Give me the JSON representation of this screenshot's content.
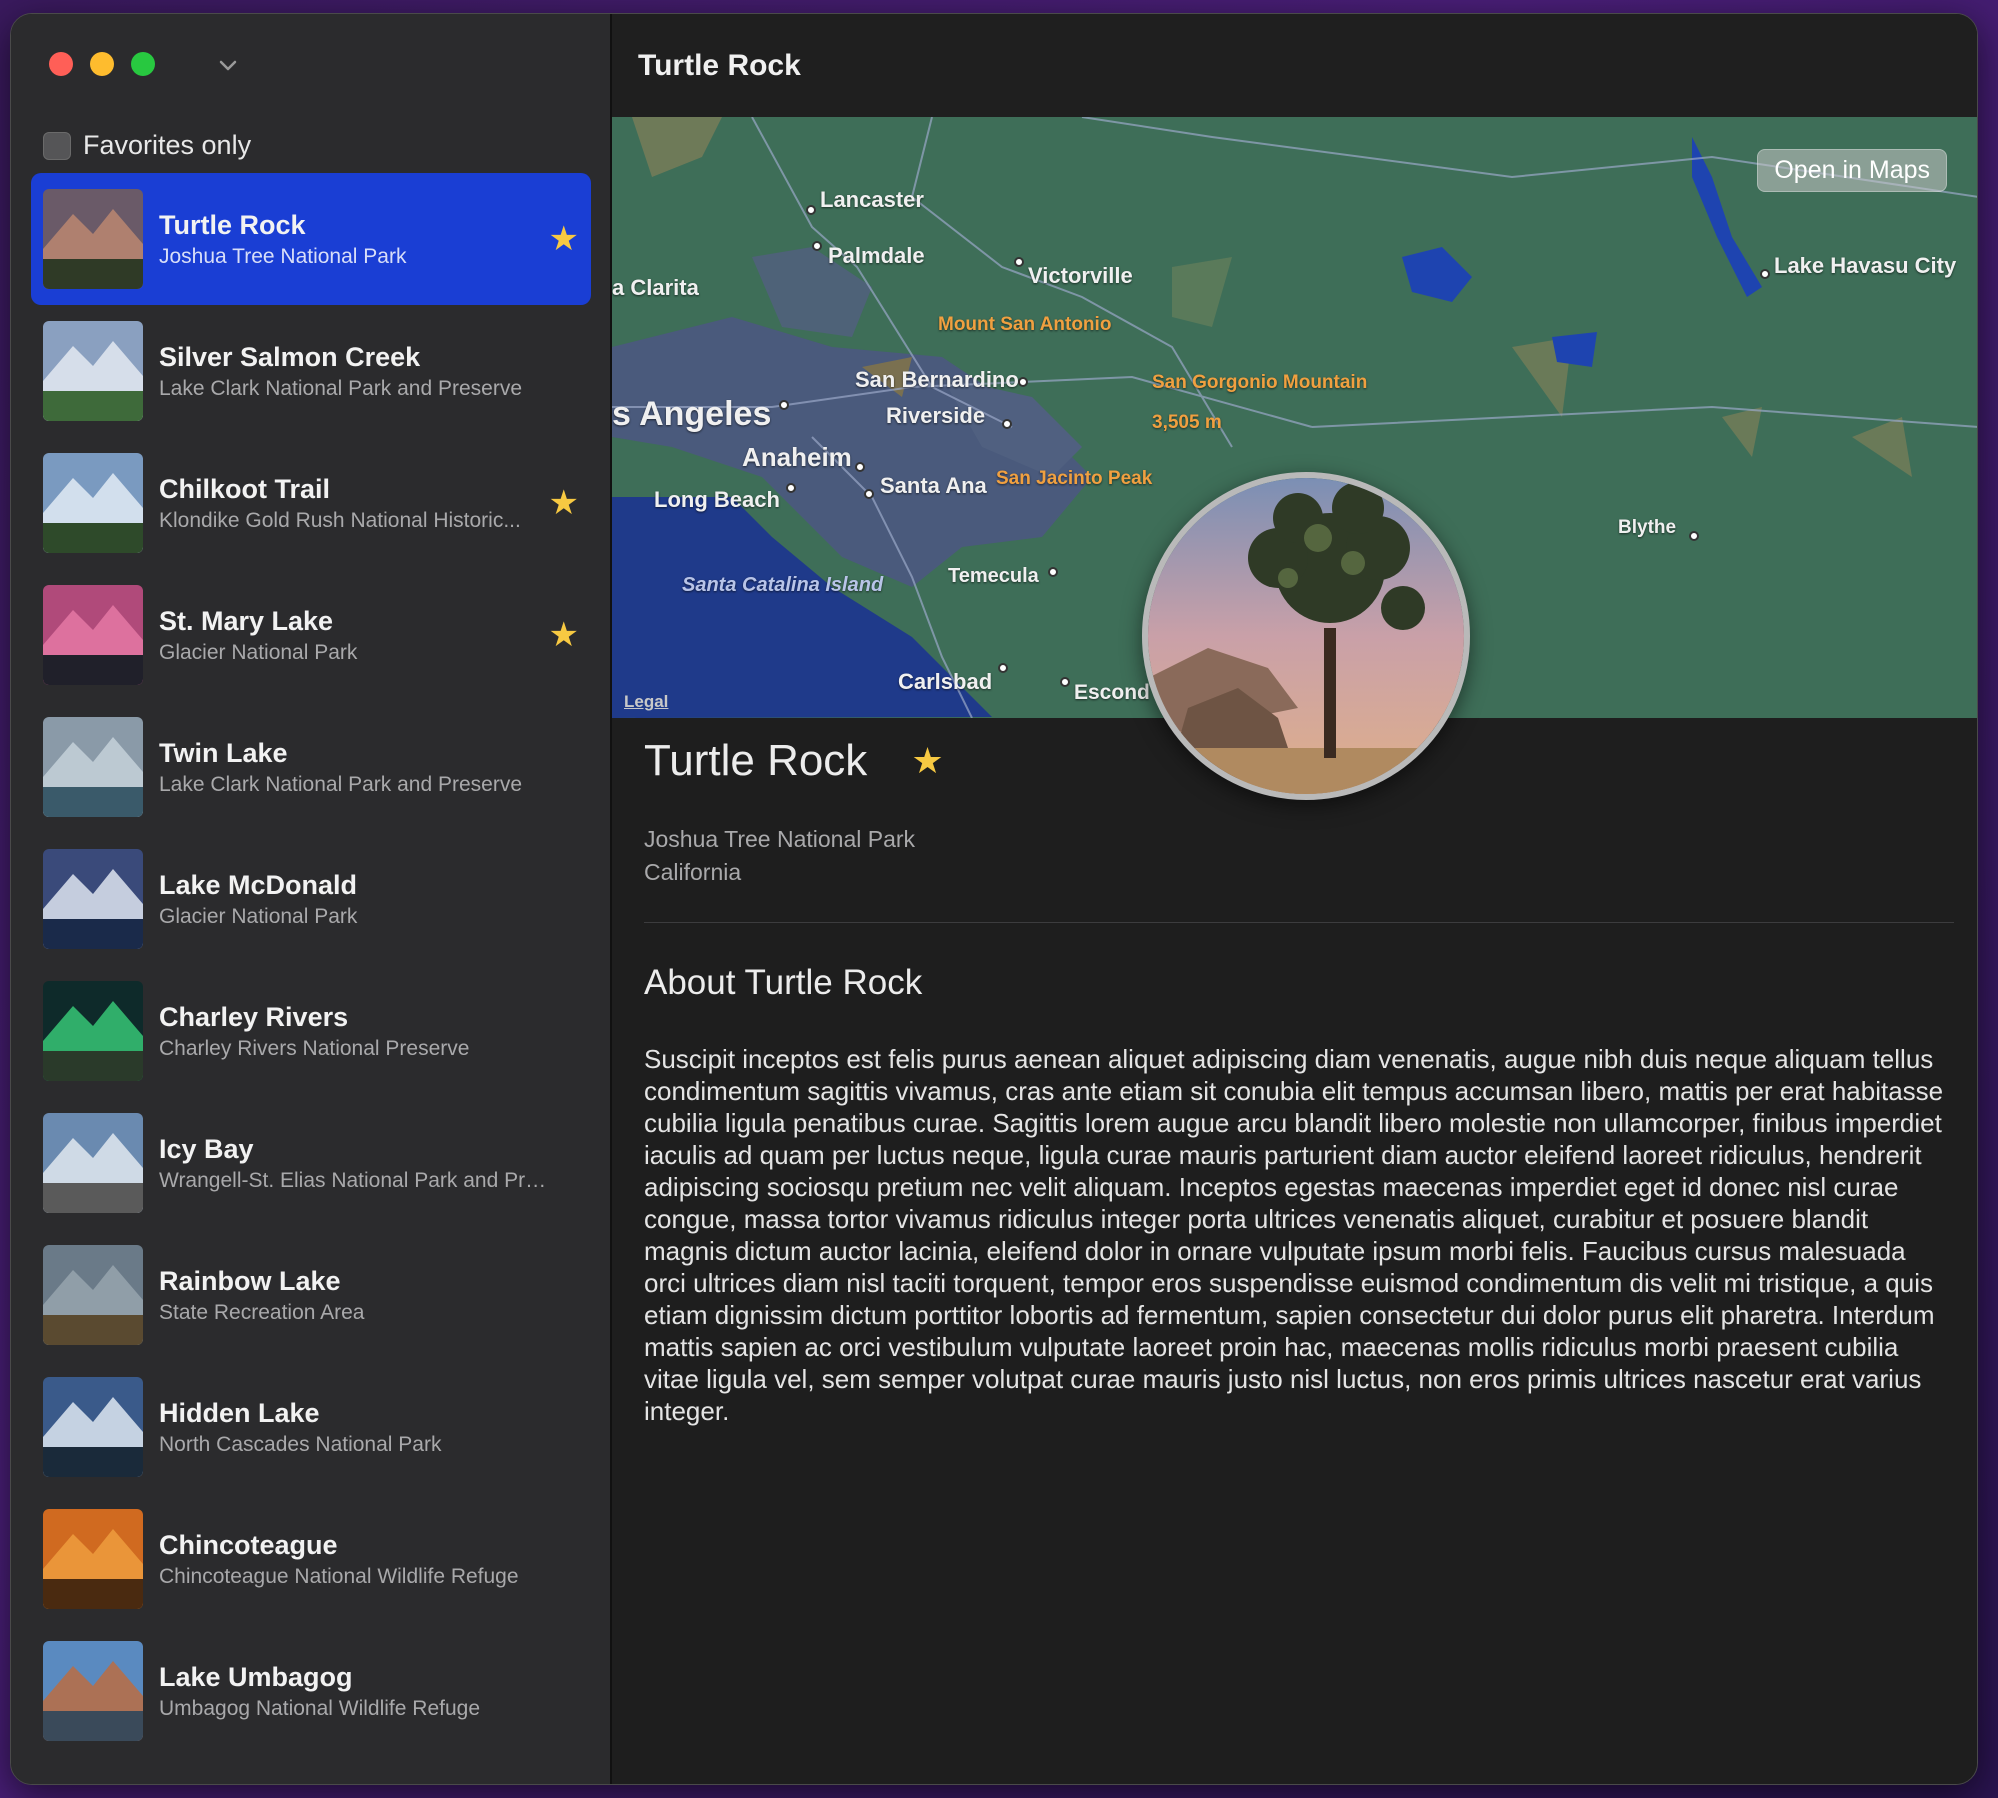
{
  "window": {
    "title": "Turtle Rock"
  },
  "sidebar": {
    "favorites_label": "Favorites only",
    "favorites_checked": false,
    "items": [
      {
        "title": "Turtle Rock",
        "subtitle": "Joshua Tree National Park",
        "favorite": true,
        "selected": true
      },
      {
        "title": "Silver Salmon Creek",
        "subtitle": "Lake Clark National Park and Preserve",
        "favorite": false,
        "selected": false
      },
      {
        "title": "Chilkoot Trail",
        "subtitle": "Klondike Gold Rush National Historic...",
        "favorite": true,
        "selected": false
      },
      {
        "title": "St. Mary Lake",
        "subtitle": "Glacier National Park",
        "favorite": true,
        "selected": false
      },
      {
        "title": "Twin Lake",
        "subtitle": "Lake Clark National Park and Preserve",
        "favorite": false,
        "selected": false
      },
      {
        "title": "Lake McDonald",
        "subtitle": "Glacier National Park",
        "favorite": false,
        "selected": false
      },
      {
        "title": "Charley Rivers",
        "subtitle": "Charley Rivers National Preserve",
        "favorite": false,
        "selected": false
      },
      {
        "title": "Icy Bay",
        "subtitle": "Wrangell-St. Elias National Park and Pre...",
        "favorite": false,
        "selected": false
      },
      {
        "title": "Rainbow Lake",
        "subtitle": "State Recreation Area",
        "favorite": false,
        "selected": false
      },
      {
        "title": "Hidden Lake",
        "subtitle": "North Cascades National Park",
        "favorite": false,
        "selected": false
      },
      {
        "title": "Chincoteague",
        "subtitle": "Chincoteague National Wildlife Refuge",
        "favorite": false,
        "selected": false
      },
      {
        "title": "Lake Umbagog",
        "subtitle": "Umbagog National Wildlife Refuge",
        "favorite": false,
        "selected": false
      }
    ]
  },
  "map": {
    "open_in_maps_label": "Open in Maps",
    "legal_label": "Legal",
    "places": {
      "lancaster": "Lancaster",
      "palmdale": "Palmdale",
      "victorville": "Victorville",
      "clarita": "a Clarita",
      "lake_havasu": "Lake Havasu City",
      "mount_san_antonio": "Mount San Antonio",
      "san_bernardino": "San Bernardino",
      "san_gorgonio": "San Gorgonio Mountain",
      "san_gorgonio_elev": "3,505 m",
      "los_angeles": "s Angeles",
      "riverside": "Riverside",
      "anaheim": "Anaheim",
      "long_beach": "Long Beach",
      "santa_ana": "Santa Ana",
      "san_jacinto": "San Jacinto Peak",
      "blythe": "Blythe",
      "temecula": "Temecula",
      "santa_catalina": "Santa Catalina Island",
      "carlsbad": "Carlsbad",
      "escondido": "Escond"
    }
  },
  "detail": {
    "title": "Turtle Rock",
    "favorite": true,
    "park": "Joshua Tree National Park",
    "state": "California",
    "about_title": "About Turtle Rock",
    "description": "Suscipit inceptos est felis purus aenean aliquet adipiscing diam venenatis, augue nibh duis neque aliquam tellus condimentum sagittis vivamus, cras ante etiam sit conubia elit tempus accumsan libero, mattis per erat habitasse cubilia ligula penatibus curae. Sagittis lorem augue arcu blandit libero molestie non ullamcorper, finibus imperdiet iaculis ad quam per luctus neque, ligula curae mauris parturient diam auctor eleifend laoreet ridiculus, hendrerit adipiscing sociosqu pretium nec velit aliquam. Inceptos egestas maecenas imperdiet eget id donec nisl curae congue, massa tortor vivamus ridiculus integer porta ultrices venenatis aliquet, curabitur et posuere blandit magnis dictum auctor lacinia, eleifend dolor in ornare vulputate ipsum morbi felis. Faucibus cursus malesuada orci ultrices diam nisl taciti torquent, tempor eros suspendisse euismod condimentum dis velit mi tristique, a quis etiam dignissim dictum porttitor lobortis ad fermentum, sapien consectetur dui dolor purus elit pharetra. Interdum mattis sapien ac orci vestibulum vulputate laoreet proin hac, maecenas mollis ridiculus morbi praesent cubilia vitae ligula vel, sem semper volutpat curae mauris justo nisl luctus, non eros primis ultrices nascetur erat varius integer."
  },
  "colors": {
    "selection": "#1a3ed4",
    "star": "#f7c942",
    "map_land": "#3e6e58",
    "map_ocean": "#1f3a8a",
    "map_urban": "#4a5a80"
  }
}
